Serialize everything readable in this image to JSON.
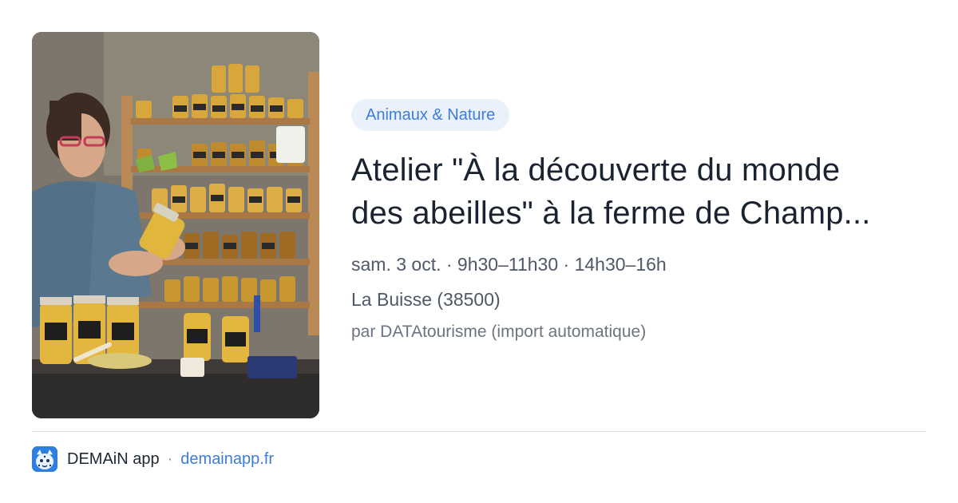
{
  "card": {
    "image_alt": "Apicultrice tenant un pot de miel devant des étagères de pots de miel",
    "category": "Animaux & Nature",
    "title_line1": "Atelier \"À la découverte du monde",
    "title_line2": "des abeilles\" à la ferme de Champ...",
    "schedule": "sam. 3 oct. · 9h30–11h30 · 14h30–16h",
    "location": "La Buisse (38500)",
    "source": "par DATAtourisme (import automatique)"
  },
  "footer": {
    "app_icon": "demain-app-icon",
    "app_name": "DEMAiN app",
    "separator": "·",
    "app_url": "demainapp.fr"
  },
  "colors": {
    "accent": "#3d7dd8",
    "badge_bg": "#eaf1fb",
    "title": "#1b2330",
    "meta": "#4e5866",
    "divider": "#dde3e9"
  }
}
